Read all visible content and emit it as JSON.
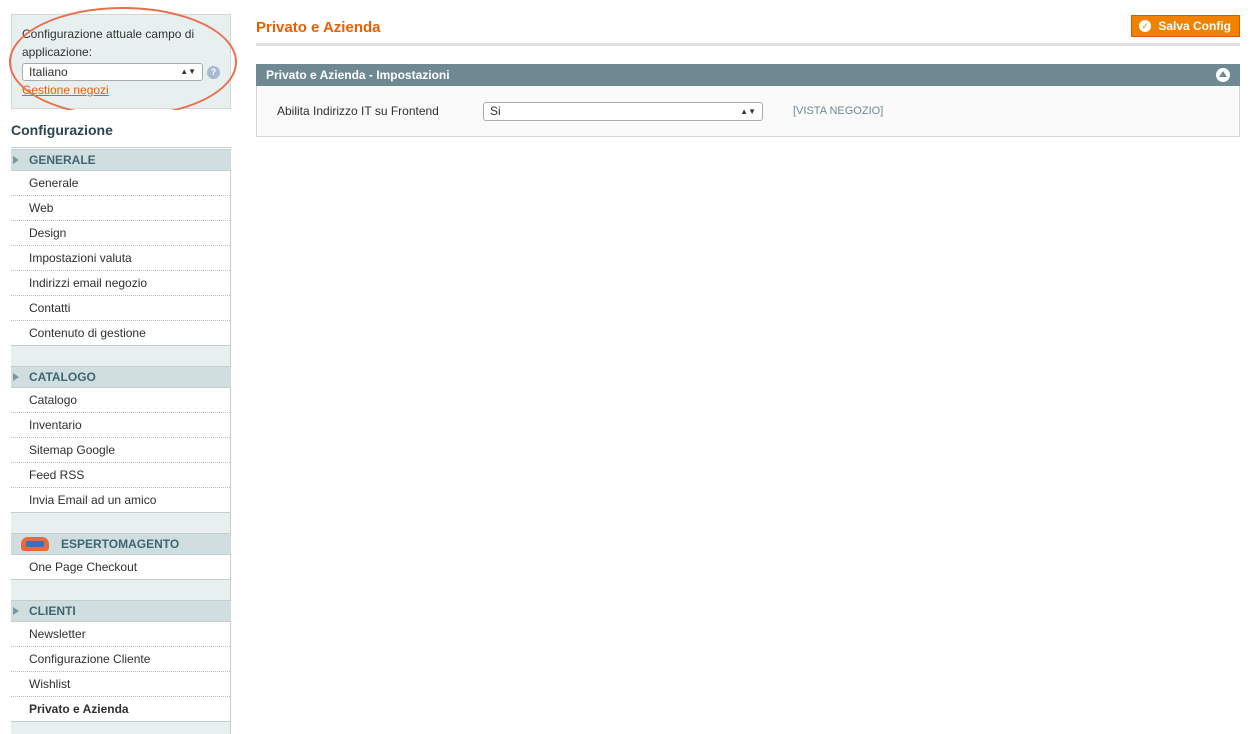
{
  "scope": {
    "label": "Configurazione attuale campo di applicazione:",
    "selected": "Italiano",
    "manage_link": "Gestione negozi"
  },
  "sidebar": {
    "title": "Configurazione",
    "sections": [
      {
        "heading": "GENERALE",
        "items": [
          "Generale",
          "Web",
          "Design",
          "Impostazioni valuta",
          "Indirizzi email negozio",
          "Contatti",
          "Contenuto di gestione"
        ]
      },
      {
        "heading": "CATALOGO",
        "items": [
          "Catalogo",
          "Inventario",
          "Sitemap Google",
          "Feed RSS",
          "Invia Email ad un amico"
        ]
      },
      {
        "heading": "ESPERTOMAGENTO",
        "items": [
          "One Page Checkout"
        ]
      },
      {
        "heading": "CLIENTI",
        "items": [
          "Newsletter",
          "Configurazione Cliente",
          "Wishlist",
          "Privato e Azienda"
        ]
      }
    ]
  },
  "main": {
    "title": "Privato e Azienda",
    "save_label": "Salva Config",
    "fieldset_title": "Privato e Azienda - Impostazioni",
    "field": {
      "label": "Abilita Indirizzo IT su Frontend",
      "value": "Si",
      "scope": "[VISTA NEGOZIO]"
    }
  },
  "colors": {
    "accent": "#eb5e00",
    "button": "#f18200",
    "fieldset_header": "#6f8992",
    "sidebar_bg": "#e7efef",
    "annotation": "#e8704d"
  }
}
